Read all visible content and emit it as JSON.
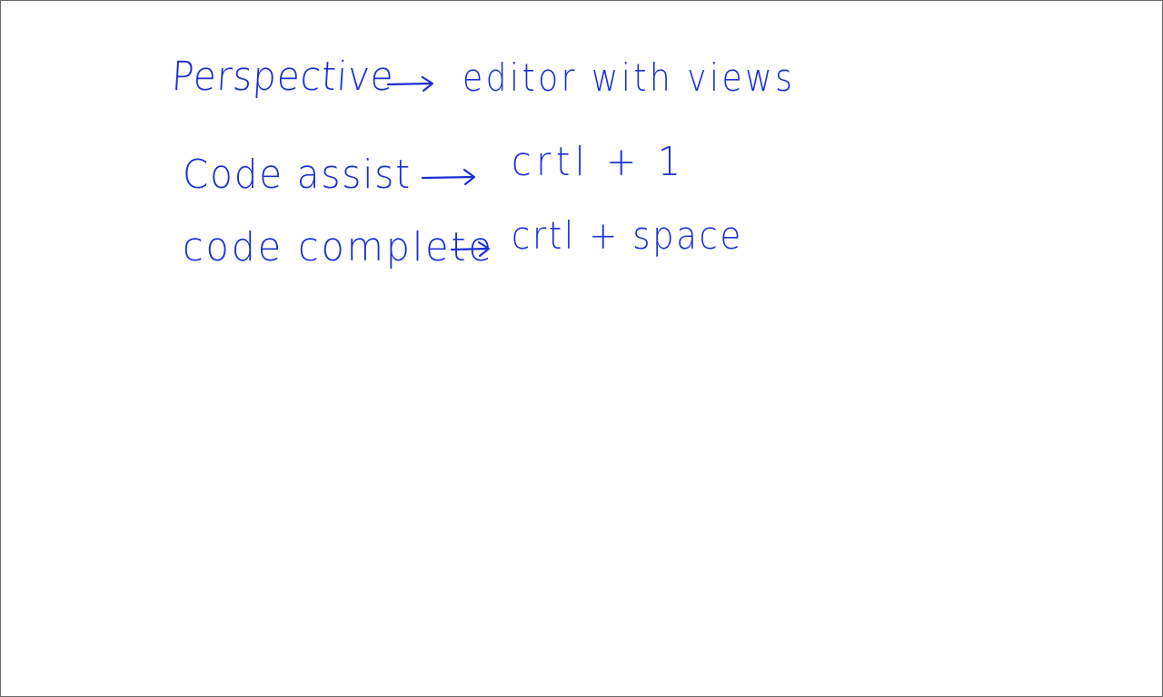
{
  "notes": {
    "ink_color": "#1a2fd6",
    "lines": [
      {
        "term": "Perspective",
        "arrow": "→",
        "meaning": "editor with views"
      },
      {
        "term": "Code assist",
        "arrow": "→",
        "meaning": "crtl + 1"
      },
      {
        "term": "code complete",
        "arrow": "→",
        "meaning": "crtl + space"
      }
    ]
  }
}
